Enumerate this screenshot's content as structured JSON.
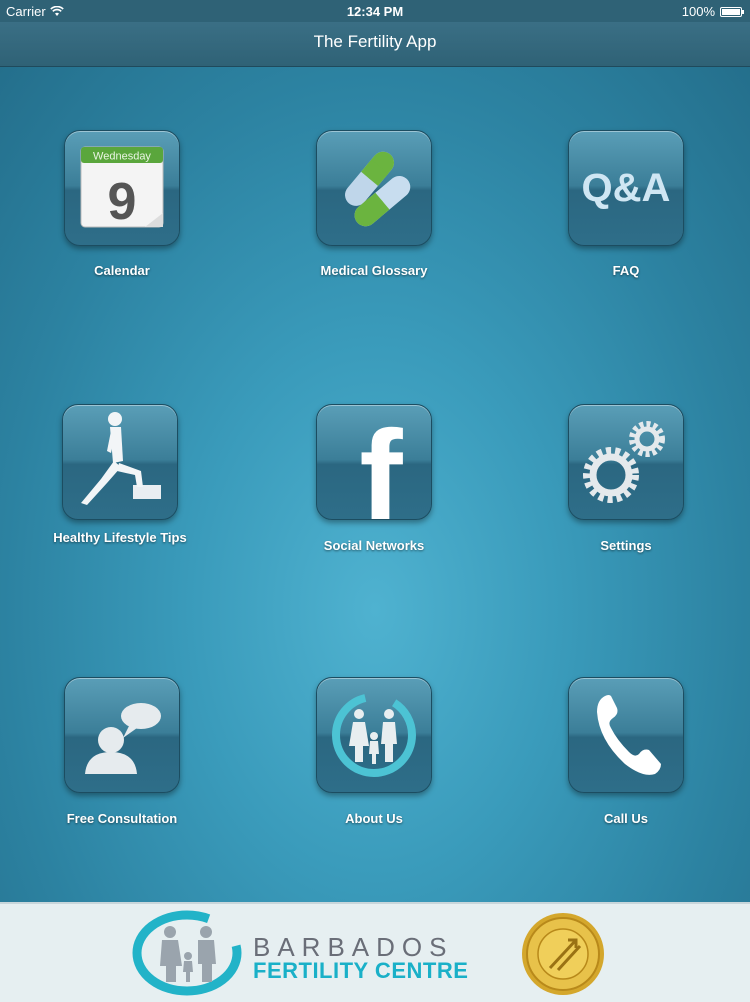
{
  "status_bar": {
    "carrier": "Carrier",
    "time": "12:34 PM",
    "battery": "100%"
  },
  "nav": {
    "title": "The Fertility App"
  },
  "tiles": [
    {
      "label": "Calendar",
      "icon": "calendar-icon",
      "day": "Wednesday",
      "date": "9"
    },
    {
      "label": "Medical Glossary",
      "icon": "pills-icon"
    },
    {
      "label": "FAQ",
      "icon": "qa-icon",
      "glyph": "Q&A"
    },
    {
      "label": "Healthy Lifestyle Tips",
      "icon": "exercise-icon"
    },
    {
      "label": "Social Networks",
      "icon": "facebook-icon",
      "glyph": "f"
    },
    {
      "label": "Settings",
      "icon": "gears-icon"
    },
    {
      "label": "Free Consultation",
      "icon": "chat-person-icon"
    },
    {
      "label": "About Us",
      "icon": "family-icon"
    },
    {
      "label": "Call Us",
      "icon": "phone-icon"
    }
  ],
  "footer": {
    "brand_line1": "BARBADOS",
    "brand_line2": "FERTILITY CENTRE"
  },
  "colors": {
    "accent": "#1ab0c8",
    "nav": "#2f6276",
    "tile": "#3b7e98"
  }
}
